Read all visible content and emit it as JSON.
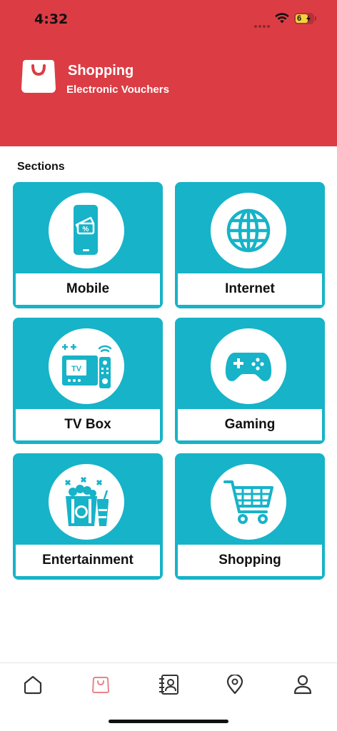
{
  "status_bar": {
    "time": "4:32",
    "battery": "6"
  },
  "header": {
    "title": "Shopping",
    "subtitle": "Electronic Vouchers",
    "color": "#dc3d45"
  },
  "main": {
    "section_title": "Sections",
    "accent": "#17b3c8",
    "cards": [
      {
        "label": "Mobile",
        "icon": "mobile-voucher-icon"
      },
      {
        "label": "Internet",
        "icon": "globe-icon"
      },
      {
        "label": "TV Box",
        "icon": "tv-box-icon"
      },
      {
        "label": "Gaming",
        "icon": "gamepad-icon"
      },
      {
        "label": "Entertainment",
        "icon": "popcorn-icon"
      },
      {
        "label": "Shopping",
        "icon": "shopping-cart-icon"
      }
    ]
  },
  "bottom_nav": {
    "items": [
      {
        "icon": "home-icon",
        "active": false
      },
      {
        "icon": "shopping-bag-icon",
        "active": true
      },
      {
        "icon": "contacts-icon",
        "active": false
      },
      {
        "icon": "location-pin-icon",
        "active": false
      },
      {
        "icon": "profile-icon",
        "active": false
      }
    ],
    "active_color": "#e8858b",
    "inactive_color": "#333333"
  }
}
